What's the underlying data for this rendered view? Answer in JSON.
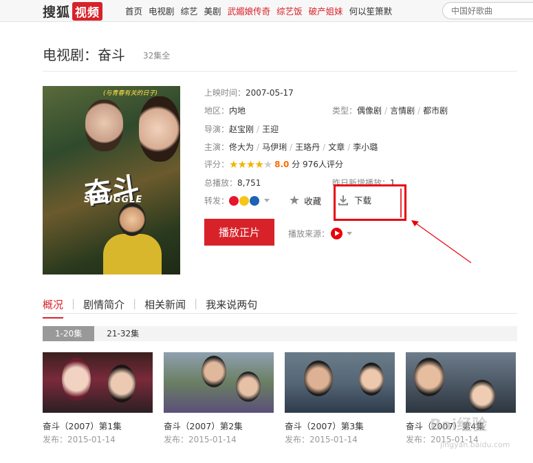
{
  "header": {
    "logo_text": "搜狐",
    "logo_badge": "视频",
    "nav": [
      {
        "label": "首页",
        "hot": false
      },
      {
        "label": "电视剧",
        "hot": false
      },
      {
        "label": "综艺",
        "hot": false
      },
      {
        "label": "美剧",
        "hot": false
      },
      {
        "label": "武媚娘传奇",
        "hot": true
      },
      {
        "label": "综艺饭",
        "hot": true
      },
      {
        "label": "破产姐妹",
        "hot": true
      },
      {
        "label": "何以笙箫默",
        "hot": false
      }
    ],
    "search_placeholder": "中国好歌曲"
  },
  "page": {
    "title": "电视剧：奋斗",
    "episode_count": "32集全"
  },
  "poster": {
    "title": "奋斗",
    "subtitle": "STRUGGLE",
    "tagline": "(与青春有关的日子)"
  },
  "info": {
    "release_label": "上映时间：",
    "release_value": "2007-05-17",
    "region_label": "地区：",
    "region_value": "内地",
    "genre_label": "类型：",
    "genres": [
      "偶像剧",
      "言情剧",
      "都市剧"
    ],
    "director_label": "导演：",
    "directors": [
      "赵宝刚",
      "王迎"
    ],
    "cast_label": "主演：",
    "cast": [
      "佟大为",
      "马伊琍",
      "王珞丹",
      "文章",
      "李小璐"
    ],
    "rating_label": "评分：",
    "rating_stars": 4,
    "rating_max": 5,
    "rating_score": "8.0",
    "rating_unit": "分",
    "rating_count": "976人评分",
    "plays_label": "总播放：",
    "plays_value": "8,751",
    "yesterday_label": "昨日新增播放：",
    "yesterday_value": "1",
    "share_label": "转发："
  },
  "actions": {
    "favorite_label": "收藏",
    "download_label": "下载",
    "play_label": "播放正片",
    "source_label": "播放来源："
  },
  "tabs": [
    {
      "label": "概况",
      "active": true
    },
    {
      "label": "剧情简介",
      "active": false
    },
    {
      "label": "相关新闻",
      "active": false
    },
    {
      "label": "我来说两句",
      "active": false
    }
  ],
  "episode_ranges": [
    {
      "label": "1-20集",
      "active": true
    },
    {
      "label": "21-32集",
      "active": false
    }
  ],
  "episodes": [
    {
      "title": "奋斗（2007）第1集",
      "date": "发布：2015-01-14"
    },
    {
      "title": "奋斗（2007）第2集",
      "date": "发布：2015-01-14"
    },
    {
      "title": "奋斗（2007）第3集",
      "date": "发布：2015-01-14"
    },
    {
      "title": "奋斗（2007）第4集",
      "date": "发布：2015-01-14"
    }
  ],
  "colors": {
    "brand_red": "#d8222a",
    "score_orange": "#ff6a00",
    "annotation_red": "#e8000b"
  },
  "watermark": {
    "text": "Bai经验",
    "sub": "jingyan.baidu.com"
  }
}
